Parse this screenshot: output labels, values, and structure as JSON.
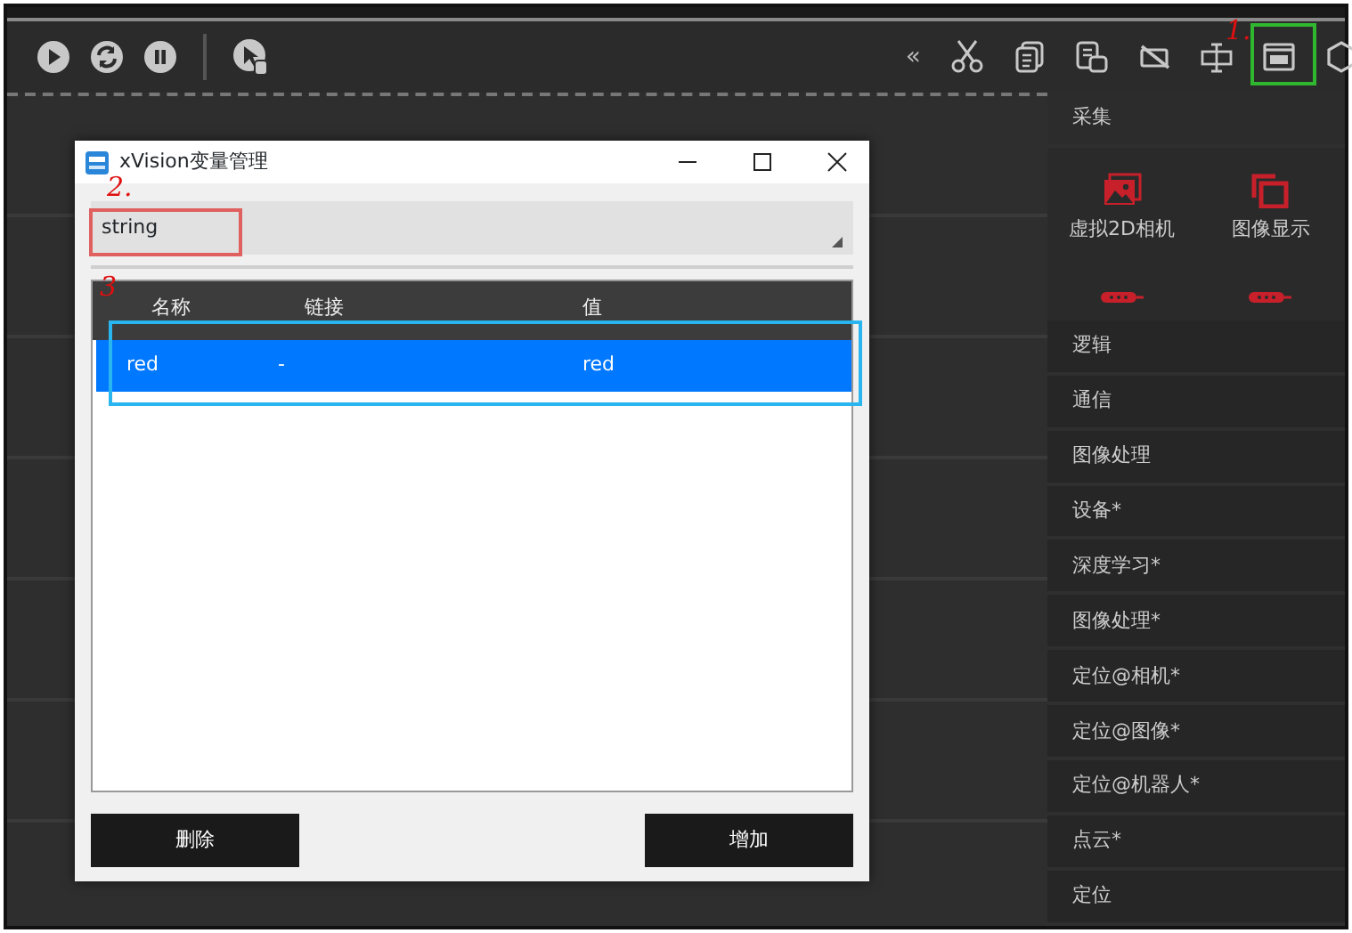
{
  "toolbar": {
    "left_buttons": [
      {
        "kind": "play"
      },
      {
        "kind": "refresh"
      },
      {
        "kind": "pause"
      },
      {
        "kind": "separator"
      },
      {
        "kind": "debug"
      }
    ],
    "collapse_label": "«",
    "right_buttons": [
      {
        "kind": "cut"
      },
      {
        "kind": "copy"
      },
      {
        "kind": "paste"
      },
      {
        "kind": "hide"
      },
      {
        "kind": "split"
      },
      {
        "kind": "variables"
      },
      {
        "kind": "more"
      }
    ]
  },
  "annotations": [
    {
      "text": "1."
    },
    {
      "text": "2."
    },
    {
      "text": "3"
    }
  ],
  "dialog": {
    "title": "xVision变量管理",
    "type_value": "string",
    "columns": [
      "名称",
      "链接",
      "值"
    ],
    "rows": [
      {
        "cells": [
          "red",
          "-",
          "red"
        ],
        "selected": true
      }
    ],
    "buttons": [
      "删除",
      "增加"
    ]
  },
  "sidebar": {
    "open_category": "采集",
    "tools": [
      "虚拟2D相机",
      "图像显示"
    ],
    "categories": [
      "逻辑",
      "通信",
      "图像处理",
      "设备*",
      "深度学习*",
      "图像处理*",
      "定位@相机*",
      "定位@图像*",
      "定位@机器人*",
      "点云*",
      "定位"
    ]
  }
}
